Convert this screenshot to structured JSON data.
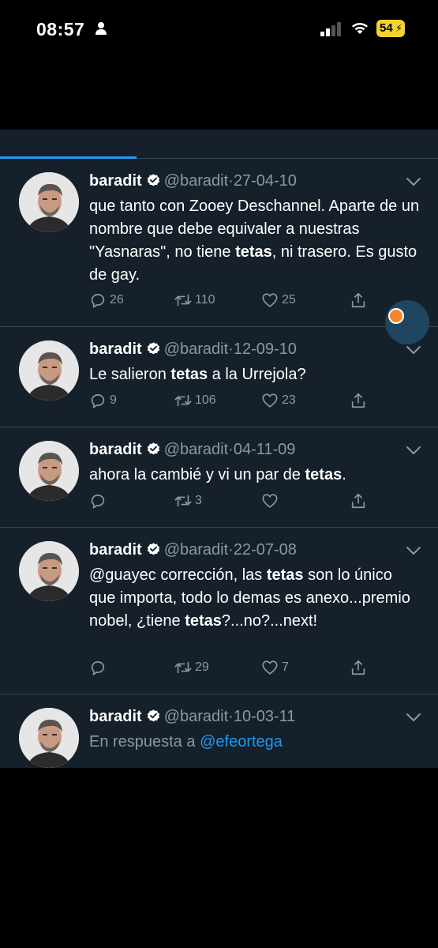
{
  "status": {
    "time": "08:57",
    "battery": "54"
  },
  "tweets": [
    {
      "name": "baradit",
      "handle": "@baradit",
      "dot": "·",
      "date": "27-04-10",
      "segments": [
        {
          "t": "que tanto con Zooey Deschannel. Aparte de un nombre que debe equivaler a nuestras \"Yasnaras\", no tiene ",
          "b": false
        },
        {
          "t": "tetas",
          "b": true
        },
        {
          "t": ", ni trasero. Es gusto de gay.",
          "b": false
        }
      ],
      "replies": "26",
      "retweets": "110",
      "likes": "25"
    },
    {
      "name": "baradit",
      "handle": "@baradit",
      "dot": "·",
      "date": "12-09-10",
      "segments": [
        {
          "t": "Le salieron ",
          "b": false
        },
        {
          "t": "tetas",
          "b": true
        },
        {
          "t": " a la Urrejola?",
          "b": false
        }
      ],
      "replies": "9",
      "retweets": "106",
      "likes": "23"
    },
    {
      "name": "baradit",
      "handle": "@baradit",
      "dot": "·",
      "date": "04-11-09",
      "segments": [
        {
          "t": "ahora la cambié y vi un par de ",
          "b": false
        },
        {
          "t": "tetas",
          "b": true
        },
        {
          "t": ".",
          "b": false
        }
      ],
      "replies": "",
      "retweets": "3",
      "likes": ""
    },
    {
      "name": "baradit",
      "handle": "@baradit",
      "dot": "·",
      "date": "22-07-08",
      "segments": [
        {
          "t": "@guayec corrección, las ",
          "b": false
        },
        {
          "t": "tetas",
          "b": true
        },
        {
          "t": " son lo único que importa, todo lo demas es anexo...premio nobel, ¿tiene ",
          "b": false
        },
        {
          "t": "tetas",
          "b": true
        },
        {
          "t": "?...no?...next!",
          "b": false
        }
      ],
      "replies": "",
      "retweets": "29",
      "likes": "7"
    },
    {
      "name": "baradit",
      "handle": "@baradit",
      "dot": "·",
      "date": "10-03-11",
      "reply_context": "En respuesta a ",
      "reply_mention": "@efeortega"
    }
  ]
}
